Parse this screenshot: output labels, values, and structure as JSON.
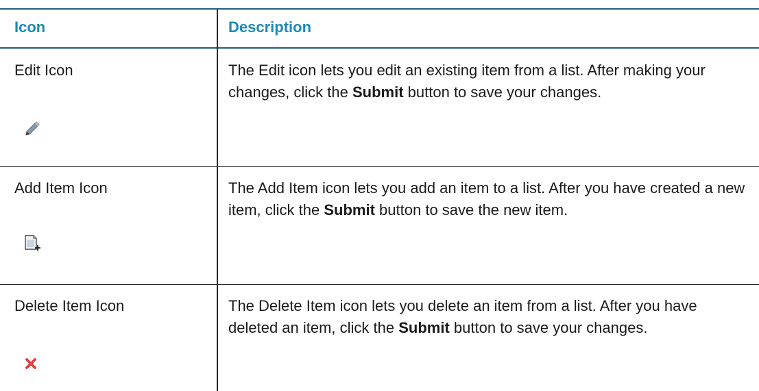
{
  "table": {
    "headers": {
      "icon": "Icon",
      "description": "Description"
    },
    "rows": [
      {
        "name": "Edit Icon",
        "icon": "pencil-icon",
        "desc_before": "The Edit icon lets you edit an existing item from a list. After making your changes, click the ",
        "desc_bold": "Submit",
        "desc_after": " button to save your changes."
      },
      {
        "name": "Add Item Icon",
        "icon": "add-document-icon",
        "desc_before": "The Add Item icon lets you add an item to a list. After you have created a new item, click the ",
        "desc_bold": "Submit",
        "desc_after": " button to save the new item."
      },
      {
        "name": "Delete Item Icon",
        "icon": "red-x-icon",
        "desc_before": "The Delete Item icon lets you delete an item from a list. After you have deleted an item, click the ",
        "desc_bold": "Submit",
        "desc_after": " button to save your changes."
      }
    ]
  },
  "colors": {
    "header_text": "#1b8ab8",
    "rule": "#1f5f7a",
    "delete_icon": "#cc1f1f"
  }
}
